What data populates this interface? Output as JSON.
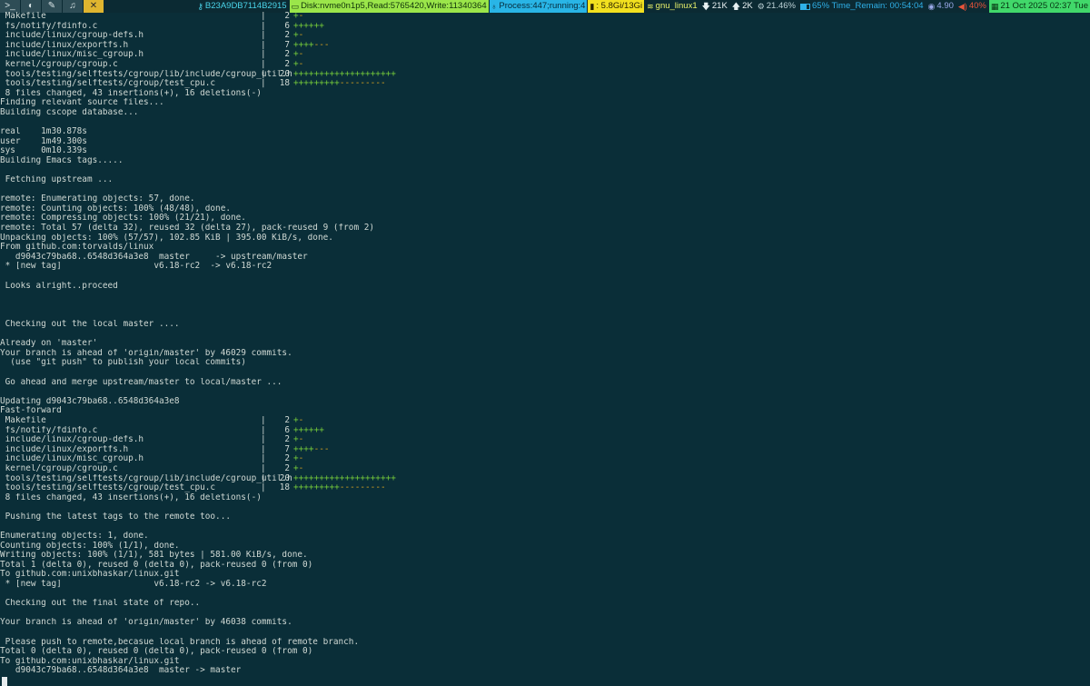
{
  "workspaces": [
    {
      "label": ">_",
      "icon": "terminal-icon",
      "active": false
    },
    {
      "label": "◐",
      "icon": "browser-icon",
      "active": false
    },
    {
      "label": "✎",
      "icon": "editor-icon",
      "active": false
    },
    {
      "label": "♫",
      "icon": "music-icon",
      "active": false
    },
    {
      "label": "✕",
      "icon": "tools-icon",
      "active": true
    }
  ],
  "statusbar": {
    "host_id": "B23A9DB7114B2915",
    "disk": "Disk:nvme0n1p5,Read:5765420,Write:11340364",
    "process": "Process:447;running:4",
    "memory": ": 5.8Gi/13Gi",
    "wifi": "gnu_linux1",
    "net_down": "21K",
    "net_up": "2K",
    "cpu": "21.46%",
    "battery": "65% Time_Remain: 00:54:04",
    "load": "4.90",
    "volume": "40%",
    "datetime": "21 Oct 2025 02:37 Tue"
  },
  "diffstat_1": {
    "files": [
      {
        "name": " Makefile",
        "count": "2",
        "plus": "+",
        "minus": "-"
      },
      {
        "name": " fs/notify/fdinfo.c",
        "count": "6",
        "plus": "++++++",
        "minus": ""
      },
      {
        "name": " include/linux/cgroup-defs.h",
        "count": "2",
        "plus": "+",
        "minus": "-"
      },
      {
        "name": " include/linux/exportfs.h",
        "count": "7",
        "plus": "++++",
        "minus": "---"
      },
      {
        "name": " include/linux/misc_cgroup.h",
        "count": "2",
        "plus": "+",
        "minus": "-"
      },
      {
        "name": " kernel/cgroup/cgroup.c",
        "count": "2",
        "plus": "+",
        "minus": "-"
      },
      {
        "name": " tools/testing/selftests/cgroup/lib/include/cgroup_util.h",
        "count": "20",
        "plus": "++++++++++++++++++++",
        "minus": ""
      },
      {
        "name": " tools/testing/selftests/cgroup/test_cpu.c",
        "count": "18",
        "plus": "+++++++++",
        "minus": "---------"
      }
    ]
  },
  "lines_a": [
    " 8 files changed, 43 insertions(+), 16 deletions(-)",
    "Finding relevant source files...",
    "Building cscope database...",
    "",
    "real    1m30.878s",
    "user    1m49.300s",
    "sys     0m10.339s",
    "Building Emacs tags.....",
    "",
    " Fetching upstream ...",
    "",
    "remote: Enumerating objects: 57, done.",
    "remote: Counting objects: 100% (48/48), done.",
    "remote: Compressing objects: 100% (21/21), done.",
    "remote: Total 57 (delta 32), reused 32 (delta 27), pack-reused 9 (from 2)",
    "Unpacking objects: 100% (57/57), 102.85 KiB | 395.00 KiB/s, done.",
    "From github.com:torvalds/linux",
    "   d9043c79ba68..6548d364a3e8  master     -> upstream/master",
    " * [new tag]                  v6.18-rc2  -> v6.18-rc2",
    "",
    " Looks alright..proceed",
    "",
    "",
    "",
    " Checking out the local master ....",
    "",
    "Already on 'master'",
    "Your branch is ahead of 'origin/master' by 46029 commits.",
    "  (use \"git push\" to publish your local commits)",
    "",
    " Go ahead and merge upstream/master to local/master ...",
    "",
    "Updating d9043c79ba68..6548d364a3e8",
    "Fast-forward"
  ],
  "diffstat_2": {
    "files": [
      {
        "name": " Makefile",
        "count": "2",
        "plus": "+",
        "minus": "-"
      },
      {
        "name": " fs/notify/fdinfo.c",
        "count": "6",
        "plus": "++++++",
        "minus": ""
      },
      {
        "name": " include/linux/cgroup-defs.h",
        "count": "2",
        "plus": "+",
        "minus": "-"
      },
      {
        "name": " include/linux/exportfs.h",
        "count": "7",
        "plus": "++++",
        "minus": "---"
      },
      {
        "name": " include/linux/misc_cgroup.h",
        "count": "2",
        "plus": "+",
        "minus": "-"
      },
      {
        "name": " kernel/cgroup/cgroup.c",
        "count": "2",
        "plus": "+",
        "minus": "-"
      },
      {
        "name": " tools/testing/selftests/cgroup/lib/include/cgroup_util.h",
        "count": "20",
        "plus": "++++++++++++++++++++",
        "minus": ""
      },
      {
        "name": " tools/testing/selftests/cgroup/test_cpu.c",
        "count": "18",
        "plus": "+++++++++",
        "minus": "---------"
      }
    ]
  },
  "lines_b": [
    " 8 files changed, 43 insertions(+), 16 deletions(-)",
    "",
    " Pushing the latest tags to the remote too...",
    "",
    "Enumerating objects: 1, done.",
    "Counting objects: 100% (1/1), done.",
    "Writing objects: 100% (1/1), 581 bytes | 581.00 KiB/s, done.",
    "Total 1 (delta 0), reused 0 (delta 0), pack-reused 0 (from 0)",
    "To github.com:unixbhaskar/linux.git",
    " * [new tag]                  v6.18-rc2 -> v6.18-rc2",
    "",
    " Checking out the final state of repo..",
    "",
    "Your branch is ahead of 'origin/master' by 46038 commits.",
    "",
    " Please push to remote,becasue local branch is ahead of remote branch.",
    "Total 0 (delta 0), reused 0 (delta 0), pack-reused 0 (from 0)",
    "To github.com:unixbhaskar/linux.git",
    "   d9043c79ba68..6548d364a3e8  master -> master"
  ]
}
